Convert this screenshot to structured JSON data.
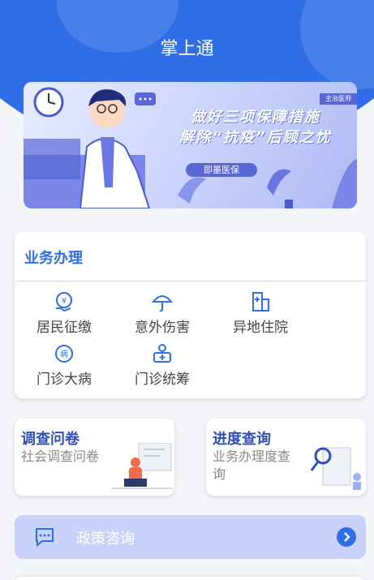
{
  "header": {
    "title": "掌上通",
    "background": "#2f6ee6"
  },
  "banner": {
    "headline_line1": "做好三项保障措施",
    "headline_line2": "解除“抗疫”后顾之忧",
    "pill": "即墨医保",
    "corner_tag": "主治医师"
  },
  "services": {
    "title": "业务办理",
    "items": [
      {
        "label": "居民征缴",
        "icon": "payment-icon"
      },
      {
        "label": "意外伤害",
        "icon": "umbrella-icon"
      },
      {
        "label": "异地住院",
        "icon": "hospital-building-icon"
      },
      {
        "label": "门诊大病",
        "icon": "disease-icon"
      },
      {
        "label": "门诊统筹",
        "icon": "medical-kit-icon"
      }
    ]
  },
  "survey": {
    "title": "调查问卷",
    "subtitle": "社会调查问卷"
  },
  "progress": {
    "title": "进度查询",
    "subtitle_line1": "业务办理度查",
    "subtitle_line2": "询"
  },
  "policy": {
    "label": "政策咨询",
    "icon": "chat-icon"
  },
  "colors": {
    "accent": "#2f6ee6",
    "policy_bg": "#c9d3fa"
  }
}
